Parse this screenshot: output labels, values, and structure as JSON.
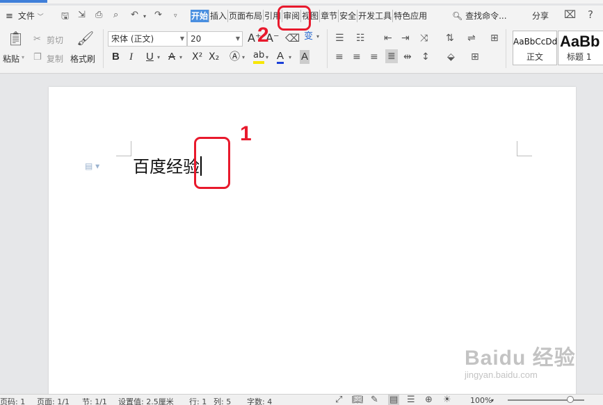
{
  "menubar": {
    "file_label": "文件",
    "tabs": [
      "开始",
      "插入",
      "页面布局",
      "引用",
      "审阅",
      "视图",
      "章节",
      "安全",
      "开发工具",
      "特色应用"
    ],
    "active_tab": "开始",
    "search_placeholder": "查找命令...",
    "share_label": "分享"
  },
  "ribbon": {
    "clipboard": {
      "paste_label": "粘贴",
      "cut_label": "剪切",
      "copy_label": "复制",
      "format_painter_label": "格式刷"
    },
    "font": {
      "font_name": "宋体 (正文)",
      "font_size": "20",
      "bold": "B",
      "italic": "I",
      "underline": "U",
      "strike": "A",
      "superscript": "X²",
      "subscript": "X₂",
      "font_color": "A",
      "char_shading": "A",
      "grow": "A⁺",
      "shrink": "A⁻",
      "phonetic": "变"
    },
    "styles": {
      "normal_sample": "AaBbCcDd",
      "normal_label": "正文",
      "heading1_sample": "AaBb",
      "heading1_label": "标题 1"
    }
  },
  "document": {
    "text": "百度经验"
  },
  "annotations": {
    "step1": "1",
    "step2": "2"
  },
  "watermark": {
    "brand": "Baidu 经验",
    "url": "jingyan.baidu.com"
  },
  "statusbar": {
    "page_num": "页码: 1",
    "page_of": "页面: 1/1",
    "section": "节: 1/1",
    "position": "设置值: 2.5厘米",
    "line": "行: 1",
    "column": "列: 5",
    "word_count": "字数: 4",
    "zoom": "100%"
  },
  "colors": {
    "accent": "#4a8fe0",
    "annotation": "#e8192c",
    "font_color_underline": "#1a3fd8",
    "highlight": "#f7e600"
  }
}
